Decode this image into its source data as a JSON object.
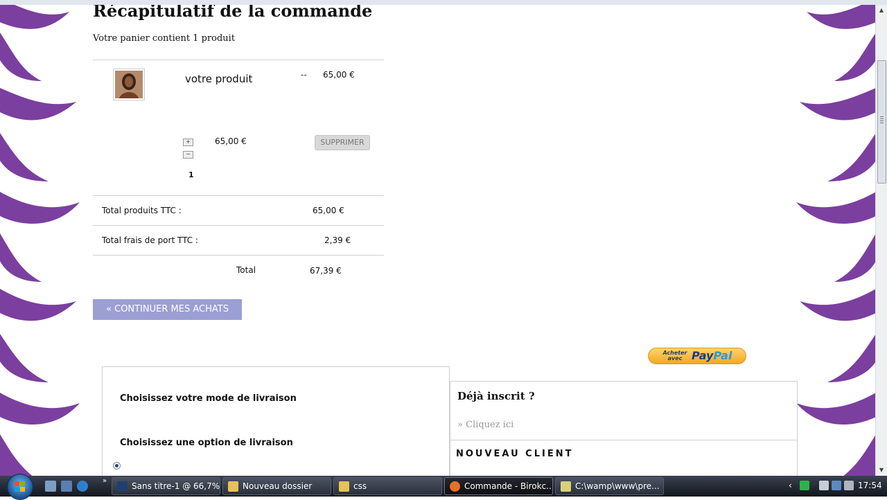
{
  "page": {
    "title": "Récapitulatif de la commande",
    "cart_count": "Votre panier contient 1 produit"
  },
  "cart": {
    "product_name": "votre produit",
    "dash": "--",
    "unit_price": "65,00 €",
    "line_total": "65,00 €",
    "quantity": "1",
    "plus": "+",
    "minus": "−",
    "delete_label": "SUPPRIMER"
  },
  "totals": {
    "products_label": "Total produits TTC :",
    "products_value": "65,00 €",
    "shipping_label": "Total frais de port TTC :",
    "shipping_value": "2,39 €",
    "total_label": "Total",
    "total_value": "67,39 €"
  },
  "actions": {
    "continue_label": "« CONTINUER MES ACHATS",
    "paypal_small": "Acheter avec",
    "paypal_brand_a": "Pay",
    "paypal_brand_b": "Pal"
  },
  "delivery": {
    "mode_label": "Choisissez votre mode de livraison",
    "option_label": "Choisissez une option de livraison"
  },
  "login": {
    "already": "Déjà inscrit ?",
    "click_here": "» Cliquez ici",
    "new_client": "NOUVEAU CLIENT"
  },
  "taskbar": {
    "buttons": [
      {
        "label": "Sans titre-1 @ 66,7%..."
      },
      {
        "label": "Nouveau dossier"
      },
      {
        "label": "css"
      },
      {
        "label": "Commande - Birokc..."
      },
      {
        "label": "C:\\wamp\\www\\pre..."
      }
    ],
    "clock": "17:54",
    "overflow_chevron": "»",
    "tray_chevron": "‹"
  },
  "colors": {
    "deco_purple": "#7b3fa0",
    "continue_bg": "#9b9fd4",
    "paypal_gold": "#f5a623"
  }
}
